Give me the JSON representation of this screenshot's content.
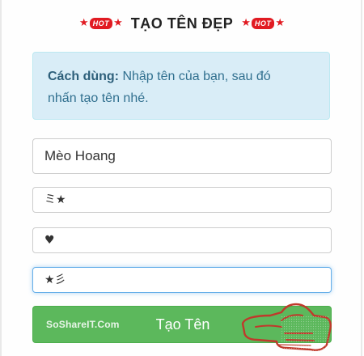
{
  "header": {
    "title": "TẠO TÊN ĐẸP",
    "hot_label": "HOT",
    "star": "★"
  },
  "instructions": {
    "bold_label": "Cách dùng:",
    "line1": " Nhập tên của bạn, sau đó",
    "line2": "nhấn tạo tên nhé."
  },
  "form": {
    "name_value": "Mèo Hoang",
    "prefix_value": "ミ★",
    "middle_value": "♥",
    "suffix_value": "★彡"
  },
  "submit": {
    "label": "Tạo Tên",
    "watermark": "SoShareIT.Com"
  },
  "colors": {
    "hot_red": "#e11b22",
    "alert_bg": "#d9edf7",
    "button_green": "#5cb85c"
  }
}
